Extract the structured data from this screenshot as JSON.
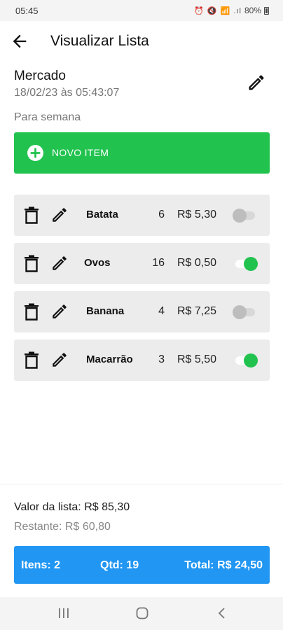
{
  "status_bar": {
    "time": "05:45",
    "icons": "⏰ 🔇 📶 .ıl",
    "battery": "80%"
  },
  "app_bar": {
    "title": "Visualizar Lista"
  },
  "list": {
    "name": "Mercado",
    "date": "18/02/23 às 05:43:07",
    "description": "Para semana"
  },
  "new_item_button": {
    "label": "NOVO ITEM"
  },
  "items": [
    {
      "name": "Batata",
      "qty": "6",
      "price": "R$ 5,30",
      "checked": false
    },
    {
      "name": "Ovos",
      "qty": "16",
      "price": "R$ 0,50",
      "checked": true
    },
    {
      "name": "Banana",
      "qty": "4",
      "price": "R$ 7,25",
      "checked": false
    },
    {
      "name": "Macarrão",
      "qty": "3",
      "price": "R$ 5,50",
      "checked": true
    }
  ],
  "footer": {
    "total_value": "Valor da lista: R$ 85,30",
    "remaining": "Restante: R$ 60,80"
  },
  "summary": {
    "items": "Itens: 2",
    "qtd": "Qtd: 19",
    "total": "Total: R$ 24,50"
  },
  "colors": {
    "green": "#22c24f",
    "blue": "#2196f3",
    "card": "#ececec"
  }
}
